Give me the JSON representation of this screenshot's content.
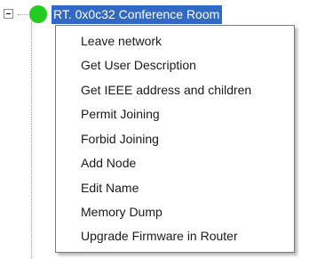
{
  "tree": {
    "node": {
      "label": "RT. 0x0c32 Conference Room",
      "status_color": "#22cc22",
      "selected_bg": "#316ac5"
    }
  },
  "context_menu": {
    "items": [
      {
        "label": "Leave network"
      },
      {
        "label": "Get User Description"
      },
      {
        "label": "Get IEEE address and children"
      },
      {
        "label": "Permit Joining"
      },
      {
        "label": "Forbid Joining"
      },
      {
        "label": "Add Node"
      },
      {
        "label": "Edit Name"
      },
      {
        "label": "Memory Dump"
      },
      {
        "label": "Upgrade Firmware in Router"
      }
    ]
  }
}
